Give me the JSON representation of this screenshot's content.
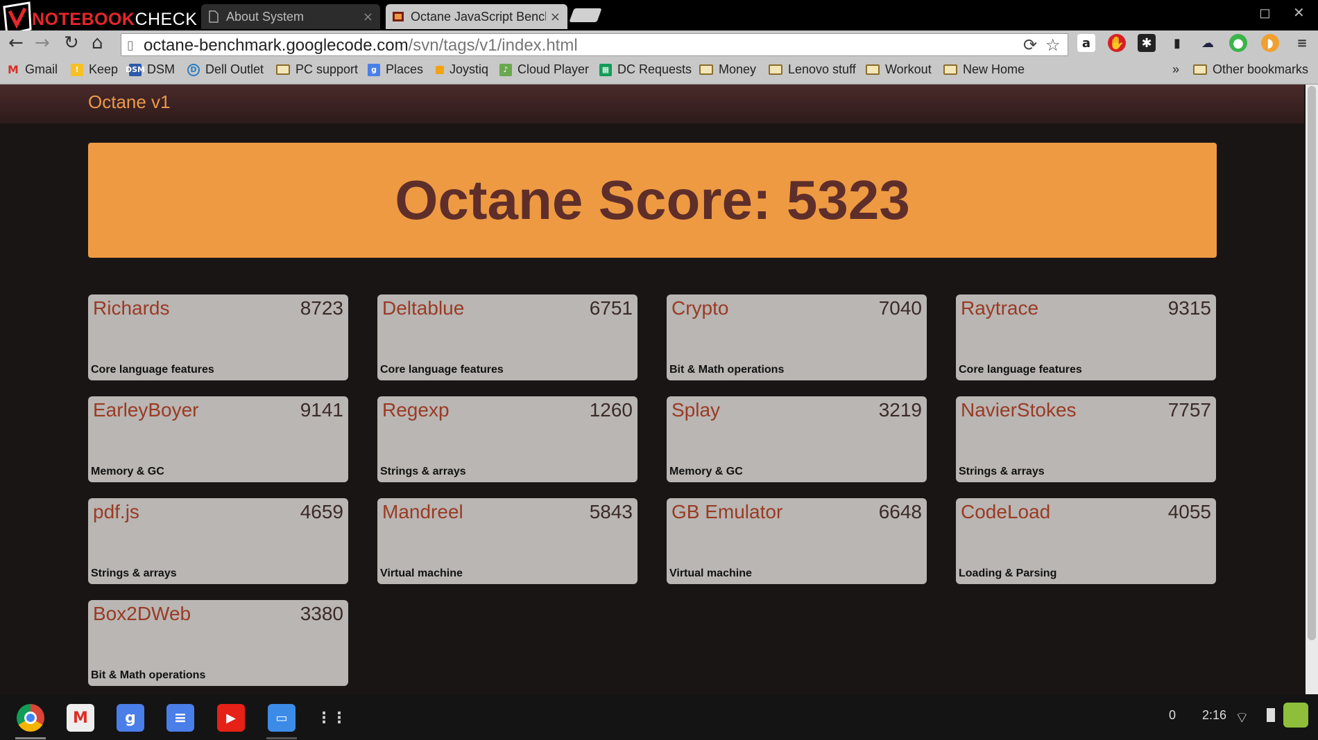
{
  "browser": {
    "logo": {
      "brand": "NOTEBOOK",
      "check": "CHECK"
    },
    "tabs": [
      {
        "title": "About System",
        "active": false,
        "close": "×"
      },
      {
        "title": "Octane JavaScript Bench",
        "active": true,
        "close": "×"
      }
    ],
    "window_controls": {
      "maximize": "◻",
      "close": "✕"
    },
    "url": {
      "host": "octane-benchmark.googlecode.com",
      "path": "/svn/tags/v1/index.html"
    },
    "nav": {
      "back": "←",
      "forward": "→",
      "reload": "↻",
      "home": "⌂"
    },
    "bookmarks": [
      "Gmail",
      "Keep",
      "DSM",
      "Dell Outlet",
      "PC support",
      "Places",
      "Joystiq",
      "Cloud Player",
      "DC Requests",
      "Money",
      "Lenovo stuff",
      "Workout",
      "New Home"
    ],
    "bookmarks_overflow": "»",
    "other_bookmarks": "Other bookmarks"
  },
  "page": {
    "title": "Octane v1",
    "score_text": "Octane Score: 5323",
    "tests": [
      {
        "name": "Richards",
        "score": "8723",
        "category": "Core language features"
      },
      {
        "name": "Deltablue",
        "score": "6751",
        "category": "Core language features"
      },
      {
        "name": "Crypto",
        "score": "7040",
        "category": "Bit & Math operations"
      },
      {
        "name": "Raytrace",
        "score": "9315",
        "category": "Core language features"
      },
      {
        "name": "EarleyBoyer",
        "score": "9141",
        "category": "Memory & GC"
      },
      {
        "name": "Regexp",
        "score": "1260",
        "category": "Strings & arrays"
      },
      {
        "name": "Splay",
        "score": "3219",
        "category": "Memory & GC"
      },
      {
        "name": "NavierStokes",
        "score": "7757",
        "category": "Strings & arrays"
      },
      {
        "name": "pdf.js",
        "score": "4659",
        "category": "Strings & arrays"
      },
      {
        "name": "Mandreel",
        "score": "5843",
        "category": "Virtual machine"
      },
      {
        "name": "GB Emulator",
        "score": "6648",
        "category": "Virtual machine"
      },
      {
        "name": "CodeLoad",
        "score": "4055",
        "category": "Loading & Parsing"
      },
      {
        "name": "Box2DWeb",
        "score": "3380",
        "category": "Bit & Math operations"
      }
    ]
  },
  "shelf": {
    "apps": [
      "chrome",
      "gmail",
      "google-search",
      "docs",
      "youtube",
      "files",
      "app-launcher"
    ],
    "notifications": "0",
    "time": "2:16"
  },
  "colors": {
    "banner": "#ee9a43",
    "score_text": "#5e2e2a",
    "tile": "#b9b6b3",
    "tile_name": "#9a3a24",
    "page_title": "#ec9a4b"
  }
}
